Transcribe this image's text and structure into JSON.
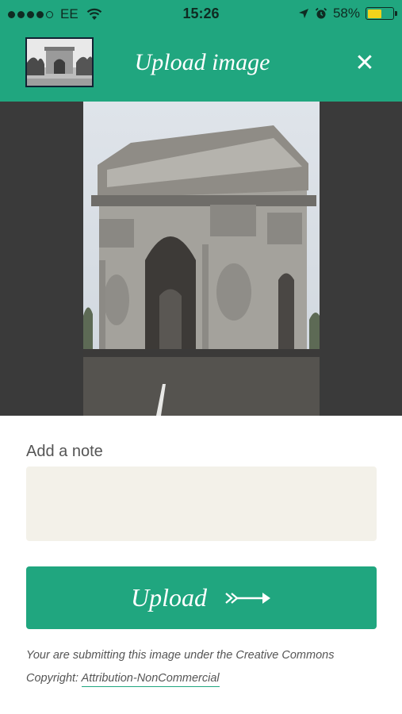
{
  "status_bar": {
    "carrier": "EE",
    "time": "15:26",
    "battery": "58%",
    "battery_level": 0.58,
    "icons": [
      "signal-dots",
      "wifi-icon",
      "location-arrow-icon",
      "alarm-icon",
      "battery-icon"
    ]
  },
  "header": {
    "title": "Upload image",
    "close_icon": "close-icon",
    "accent_color": "#20a67f"
  },
  "note": {
    "label": "Add a note",
    "value": "",
    "placeholder": ""
  },
  "upload": {
    "label": "Upload",
    "icon": "arrow-right-icon"
  },
  "copyright": {
    "text": "Your are submitting this image under the Creative Commons Copyright: ",
    "license": "Attribution-NonCommercial"
  }
}
